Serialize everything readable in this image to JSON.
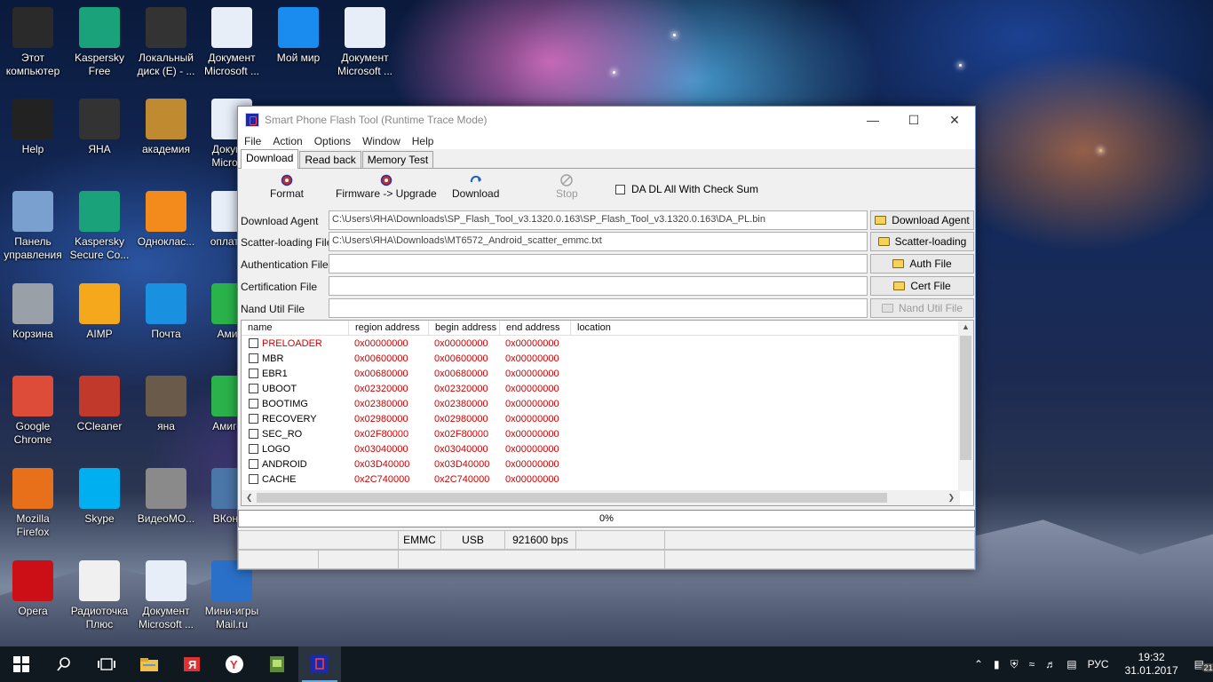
{
  "desktop": {
    "icons": [
      {
        "label": "Этот компьютер",
        "icon": "monitor-icon",
        "color": "#2a2a2a"
      },
      {
        "label": "Kaspersky Free",
        "icon": "kaspersky-icon",
        "color": "#1aa37a"
      },
      {
        "label": "Локальный диск (E) - ...",
        "icon": "drive-icon",
        "color": "#333333"
      },
      {
        "label": "Документ Microsoft ...",
        "icon": "word-doc-icon",
        "color": "#e8eef8"
      },
      {
        "label": "Мой мир",
        "icon": "moy-mir-icon",
        "color": "#1a8cf0"
      },
      {
        "label": "Документ Microsoft ...",
        "icon": "word-doc-icon",
        "color": "#e8eef8"
      },
      {
        "label": "Help",
        "icon": "help-book-icon",
        "color": "#222222"
      },
      {
        "label": "ЯНА",
        "icon": "user-folder-icon",
        "color": "#333333"
      },
      {
        "label": "академия",
        "icon": "folder-icon",
        "color": "#c08a30"
      },
      {
        "label": "Докум... Micros...",
        "icon": "word-doc-icon",
        "color": "#e8eef8"
      },
      {
        "label": "Панель управления",
        "icon": "tools-icon",
        "color": "#7aa0d0"
      },
      {
        "label": "Kaspersky Secure Co...",
        "icon": "kaspersky-secure-icon",
        "color": "#1aa37a"
      },
      {
        "label": "Одноклас...",
        "icon": "odnoklassniki-icon",
        "color": "#f28a1c"
      },
      {
        "label": "оплата...",
        "icon": "word-doc-icon",
        "color": "#e8eef8"
      },
      {
        "label": "Корзина",
        "icon": "recycle-bin-icon",
        "color": "#9aa0a8"
      },
      {
        "label": "AIMP",
        "icon": "aimp-icon",
        "color": "#f5a81c"
      },
      {
        "label": "Почта",
        "icon": "mail-icon",
        "color": "#1a90e0"
      },
      {
        "label": "Ами...",
        "icon": "amigo-icon",
        "color": "#2ab34a"
      },
      {
        "label": "Google Chrome",
        "icon": "chrome-icon",
        "color": "#dd4b39"
      },
      {
        "label": "CCleaner",
        "icon": "ccleaner-icon",
        "color": "#c0392b"
      },
      {
        "label": "яна",
        "icon": "folder-icon",
        "color": "#6a5a4a"
      },
      {
        "label": "Амиго...",
        "icon": "amigo-icon",
        "color": "#2ab34a"
      },
      {
        "label": "Mozilla Firefox",
        "icon": "firefox-icon",
        "color": "#e8701a"
      },
      {
        "label": "Skype",
        "icon": "skype-icon",
        "color": "#00aff0"
      },
      {
        "label": "ВидеоМО...",
        "icon": "video-reel-icon",
        "color": "#8a8a8a"
      },
      {
        "label": "ВКонт...",
        "icon": "vk-icon",
        "color": "#4a76a8"
      },
      {
        "label": "Opera",
        "icon": "opera-icon",
        "color": "#cc0f16"
      },
      {
        "label": "Радиоточка Плюс",
        "icon": "radio-icon",
        "color": "#f0f0f0"
      },
      {
        "label": "Документ Microsoft ...",
        "icon": "word-doc-icon",
        "color": "#e8eef8"
      },
      {
        "label": "Мини-игры Mail.ru",
        "icon": "mini-games-icon",
        "color": "#2a70c8"
      }
    ]
  },
  "window": {
    "title": "Smart Phone Flash Tool (Runtime Trace Mode)",
    "menu": [
      "File",
      "Action",
      "Options",
      "Window",
      "Help"
    ],
    "tabs": [
      "Download",
      "Read back",
      "Memory Test"
    ],
    "toolbar": {
      "format": "Format",
      "firmware_upgrade": "Firmware -> Upgrade",
      "download": "Download",
      "stop": "Stop",
      "checksum_label": "DA DL All With Check Sum"
    },
    "files": {
      "download_agent": {
        "label": "Download Agent",
        "value": "C:\\Users\\ЯНА\\Downloads\\SP_Flash_Tool_v3.1320.0.163\\SP_Flash_Tool_v3.1320.0.163\\DA_PL.bin",
        "button": "Download Agent"
      },
      "scatter": {
        "label": "Scatter-loading File",
        "value": "C:\\Users\\ЯНА\\Downloads\\MT6572_Android_scatter_emmc.txt",
        "button": "Scatter-loading"
      },
      "auth": {
        "label": "Authentication File",
        "value": "",
        "button": "Auth File"
      },
      "cert": {
        "label": "Certification File",
        "value": "",
        "button": "Cert File"
      },
      "nand": {
        "label": "Nand Util File",
        "value": "",
        "button": "Nand Util File"
      }
    },
    "table": {
      "columns": [
        "name",
        "region address",
        "begin address",
        "end address",
        "location"
      ],
      "rows": [
        {
          "name": "PRELOADER",
          "region": "0x00000000",
          "begin": "0x00000000",
          "end": "0x00000000"
        },
        {
          "name": "MBR",
          "region": "0x00600000",
          "begin": "0x00600000",
          "end": "0x00000000"
        },
        {
          "name": "EBR1",
          "region": "0x00680000",
          "begin": "0x00680000",
          "end": "0x00000000"
        },
        {
          "name": "UBOOT",
          "region": "0x02320000",
          "begin": "0x02320000",
          "end": "0x00000000"
        },
        {
          "name": "BOOTIMG",
          "region": "0x02380000",
          "begin": "0x02380000",
          "end": "0x00000000"
        },
        {
          "name": "RECOVERY",
          "region": "0x02980000",
          "begin": "0x02980000",
          "end": "0x00000000"
        },
        {
          "name": "SEC_RO",
          "region": "0x02F80000",
          "begin": "0x02F80000",
          "end": "0x00000000"
        },
        {
          "name": "LOGO",
          "region": "0x03040000",
          "begin": "0x03040000",
          "end": "0x00000000"
        },
        {
          "name": "ANDROID",
          "region": "0x03D40000",
          "begin": "0x03D40000",
          "end": "0x00000000"
        },
        {
          "name": "CACHE",
          "region": "0x2C740000",
          "begin": "0x2C740000",
          "end": "0x00000000"
        }
      ]
    },
    "progress": {
      "text": "0%",
      "value": 0
    },
    "status": {
      "storage": "EMMC",
      "port": "USB",
      "baud": "921600 bps"
    }
  },
  "taskbar": {
    "items": [
      "windows-start-icon",
      "search-icon",
      "task-view-icon",
      "file-explorer-icon",
      "yandex-browser-icon",
      "yandex-icon",
      "android-app-icon",
      "flash-tool-icon"
    ],
    "tray": {
      "lang": "РУС",
      "time": "19:32",
      "date": "31.01.2017",
      "notifications": "21"
    }
  }
}
